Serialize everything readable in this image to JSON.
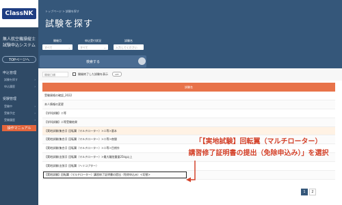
{
  "sidebar": {
    "logo_text": "ClassNK",
    "app_name": "無人航空機操縦士\n試験申込システム",
    "top_button": "TOPページへ",
    "sections": [
      {
        "title": "申込管理",
        "items": [
          "試験を探す",
          "申込履歴"
        ]
      },
      {
        "title": "受験管理",
        "items": [
          "受験中",
          "受験予定",
          "受験履歴"
        ]
      }
    ],
    "manual_button": "操作マニュアル"
  },
  "header": {
    "breadcrumb": "トップページ  >  試験を探す",
    "title": "試験を探す"
  },
  "search": {
    "fields": [
      {
        "label": "開催月",
        "value": "すべて"
      },
      {
        "label": "申込受付状況",
        "value": "すべて"
      },
      {
        "label": "試験名",
        "value": "入力してください"
      }
    ],
    "submit_label": "検索する"
  },
  "filter": {
    "sort_value": "開催日順",
    "checkbox_label": "開催終了した試験を表示",
    "toggle_label": "OFF"
  },
  "table": {
    "header": "試験名",
    "rows": [
      "受験資格の確認_2022",
      "本人情報の変更",
      "【学科試験】二等",
      "【学科試験】二等受験結果",
      "【実地試験(集合)】回転翼（マルチローター）>二等>基本",
      "【実地試験(集合)】回転翼（マルチローター）>二等>夜間",
      "【実地試験(集合)】回転翼（マルチローター）>二等>目視外",
      "【実地試験(出張)】回転翼（マルチローター）>最大離陸重量25kg以上",
      "【実地試験(出張)】回転翼（ヘリコプター）",
      "【実地試験】回転翼（マルチローター）講習修了証明書の提出（免除申込み）<切替>"
    ]
  },
  "annotation": {
    "line1": "「【実地試験】回転翼（マルチローター）",
    "line2": "講習修了証明書の提出（免除申込み）」を選択"
  },
  "pagination": {
    "pages": [
      "1",
      "2"
    ],
    "current": "1"
  },
  "colors": {
    "sidebar": "#2f4a66",
    "header": "#35577a",
    "accent": "#e8734a",
    "annotation": "#d4422a"
  }
}
